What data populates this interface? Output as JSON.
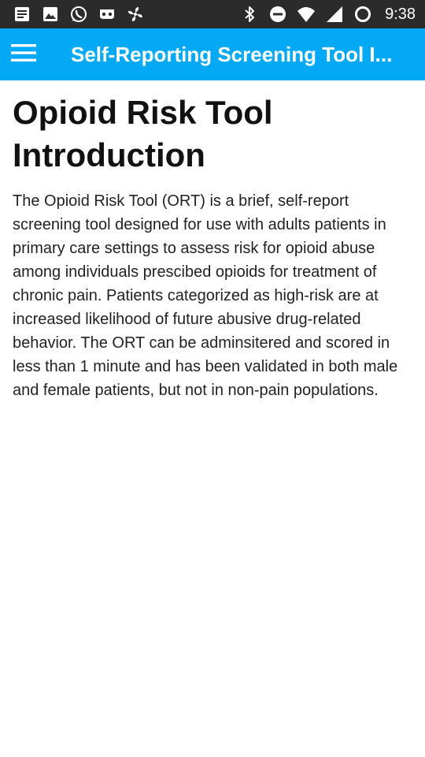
{
  "status_bar": {
    "time": "9:38",
    "left_icons": [
      "notes-icon",
      "image-icon",
      "whatsapp-icon",
      "mask-icon",
      "fan-icon"
    ],
    "right_icons": [
      "bluetooth-icon",
      "do-not-disturb-icon",
      "wifi-icon",
      "signal-icon",
      "battery-ring-icon"
    ]
  },
  "app_bar": {
    "title": "Self-Reporting Screening Tool I...",
    "color": "#03a9f4"
  },
  "main": {
    "title": "Opioid Risk Tool Introduction",
    "body": "The Opioid Risk Tool (ORT) is a brief, self-report screening tool designed for use with adults patients in primary care settings to assess risk for opioid abuse among individuals prescibed opioids for treatment of chronic pain. Patients categorized as high-risk are at increased likelihood of future abusive drug-related behavior. The ORT can be adminsitered and scored in less than 1 minute and has been validated in both male and female patients, but not in non-pain populations."
  }
}
